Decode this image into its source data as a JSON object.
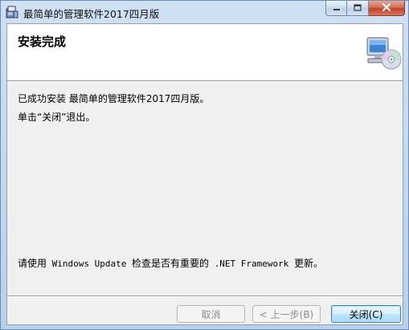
{
  "window": {
    "title": "最简单的管理软件2017四月版"
  },
  "header": {
    "title": "安装完成"
  },
  "body": {
    "line1": "已成功安装 最简单的管理软件2017四月版。",
    "line2": "单击“关闭”退出。",
    "update_prefix": "请使用",
    "update_mono1": " Windows Update ",
    "update_middle": "检查是否有重要的",
    "update_mono2": " .NET Framework ",
    "update_suffix": "更新。"
  },
  "buttons": {
    "cancel": "取消",
    "back": "< 上一步(B)",
    "close": "关闭(C)"
  },
  "icons": {
    "app": "installer-icon",
    "header": "computer-cd-icon",
    "minimize": "minimize-icon",
    "maximize": "maximize-icon",
    "close": "close-icon"
  }
}
